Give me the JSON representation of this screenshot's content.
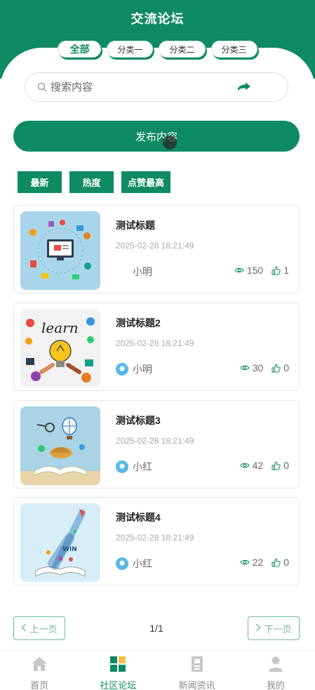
{
  "header": {
    "title": "交流论坛"
  },
  "categories": [
    {
      "label": "全部",
      "active": true
    },
    {
      "label": "分类一",
      "active": false
    },
    {
      "label": "分类二",
      "active": false
    },
    {
      "label": "分类三",
      "active": false
    }
  ],
  "search": {
    "placeholder": "搜索内容",
    "value": ""
  },
  "publish": {
    "label": "发布内容"
  },
  "sort_tabs": [
    "最新",
    "热度",
    "点赞最高"
  ],
  "posts": [
    {
      "title": "测试标题",
      "date": "2025-02-28 18:21:49",
      "author": "小明",
      "views": "150",
      "likes": "1"
    },
    {
      "title": "测试标题2",
      "date": "2025-02-28 18:21:49",
      "author": "小明",
      "views": "30",
      "likes": "0"
    },
    {
      "title": "测试标题3",
      "date": "2025-02-28 18:21:49",
      "author": "小红",
      "views": "42",
      "likes": "0"
    },
    {
      "title": "测试标题4",
      "date": "2025-02-28 18:21:49",
      "author": "小红",
      "views": "22",
      "likes": "0"
    }
  ],
  "pagination": {
    "prev": "上一页",
    "next": "下一页",
    "info": "1/1"
  },
  "tabbar": [
    {
      "label": "首页",
      "icon": "home-icon",
      "active": false
    },
    {
      "label": "社区论坛",
      "icon": "grid-icon",
      "active": true
    },
    {
      "label": "新闻资讯",
      "icon": "news-icon",
      "active": false
    },
    {
      "label": "我的",
      "icon": "user-icon",
      "active": false
    }
  ],
  "colors": {
    "primary": "#0e8a65",
    "accent": "#f5c04a"
  }
}
